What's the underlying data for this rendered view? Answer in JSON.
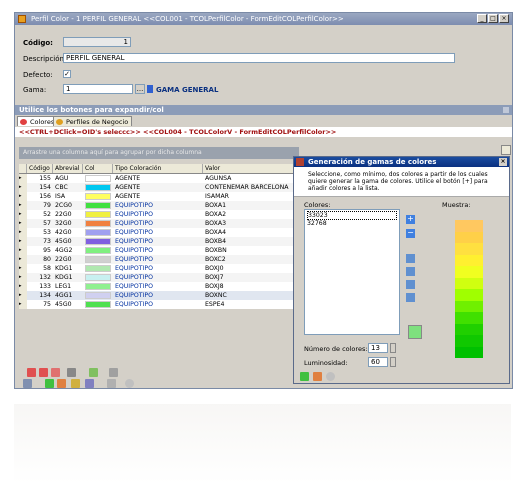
{
  "window": {
    "title": "Perfil Color - 1  PERFIL GENERAL  <<COL001 - TCOLPerfilColor - FormEditCOLPerfilColor>>",
    "controls": [
      "_",
      "□",
      "×"
    ]
  },
  "form": {
    "codigo_label": "Código:",
    "codigo_value": "1",
    "descripcion_label": "Descripción:",
    "descripcion_value": "PERFIL GENERAL",
    "defecto_label": "Defecto:",
    "defecto_checked": "✓",
    "gama_label": "Gama:",
    "gama_value": "1",
    "gama_button": "...",
    "gama_name": "GAMA GENERAL"
  },
  "expand_bar": "Utilice los botones para expandir/col",
  "tabs": [
    {
      "label": "Colores"
    },
    {
      "label": "Perfiles de Negocio"
    }
  ],
  "ctrl_bar": "<<CTRL+DClick=OID's seleccc>> <<COL004 - TCOLColorV - FormEditCOLPerfilColor>>",
  "grid": {
    "group_hint": "Arrastre una columna aquí para agrupar por dicha columna",
    "headers": [
      "Código",
      "Abrevial",
      "Col",
      "Tipo Coloración",
      "Valor"
    ],
    "rows": [
      {
        "codigo": "155",
        "abrev": "AGU",
        "color": "#ffffff",
        "tipo": "AGENTE",
        "valor": "AGUNSA"
      },
      {
        "codigo": "154",
        "abrev": "CBC",
        "color": "#00c8f0",
        "tipo": "AGENTE",
        "valor": "CONTENEMAR BARCELONA"
      },
      {
        "codigo": "156",
        "abrev": "ISA",
        "color": "#ffff60",
        "tipo": "AGENTE",
        "valor": "ISAMAR"
      },
      {
        "codigo": "79",
        "abrev": "2CG0",
        "color": "#40e040",
        "tipo": "EQUIPOTIPO",
        "valor": "BOXA1"
      },
      {
        "codigo": "52",
        "abrev": "22G0",
        "color": "#f0f040",
        "tipo": "EQUIPOTIPO",
        "valor": "BOXA2"
      },
      {
        "codigo": "57",
        "abrev": "32G0",
        "color": "#f08040",
        "tipo": "EQUIPOTIPO",
        "valor": "BOXA3"
      },
      {
        "codigo": "53",
        "abrev": "42G0",
        "color": "#a0a0f0",
        "tipo": "EQUIPOTIPO",
        "valor": "BOXA4"
      },
      {
        "codigo": "73",
        "abrev": "45G0",
        "color": "#8060e0",
        "tipo": "EQUIPOTIPO",
        "valor": "BOXB4"
      },
      {
        "codigo": "95",
        "abrev": "4GG2",
        "color": "#80f080",
        "tipo": "EQUIPOTIPO",
        "valor": "BOXBN"
      },
      {
        "codigo": "80",
        "abrev": "22G0",
        "color": "#d0d0d0",
        "tipo": "EQUIPOTIPO",
        "valor": "BOXC2"
      },
      {
        "codigo": "58",
        "abrev": "KDG1",
        "color": "#b0e8b0",
        "tipo": "EQUIPOTIPO",
        "valor": "BOXJ0"
      },
      {
        "codigo": "132",
        "abrev": "KDG1",
        "color": "#c8f0f0",
        "tipo": "EQUIPOTIPO",
        "valor": "BOXJ7"
      },
      {
        "codigo": "133",
        "abrev": "LEG1",
        "color": "#90f090",
        "tipo": "EQUIPOTIPO",
        "valor": "BOXJ8"
      },
      {
        "codigo": "134",
        "abrev": "4GG1",
        "color": "#d0d0f0",
        "tipo": "EQUIPOTIPO",
        "valor": "BOXNC"
      },
      {
        "codigo": "75",
        "abrev": "45G0",
        "color": "#50e050",
        "tipo": "EQUIPOTIPO",
        "valor": "ESPE4"
      }
    ]
  },
  "dialog": {
    "title": "Generación de gamas de colores",
    "info": "Seleccione, como mínimo, dos colores a partir de los cuales quiere generar la gama de colores. Utilice el botón [+] para añadir colores a la lista.",
    "colores_label": "Colores:",
    "colores": [
      "33023",
      "32768"
    ],
    "muestra_label": "Muestra:",
    "numero_label": "Número de colores:",
    "numero_value": "13",
    "luminosidad_label": "Luminosidad:",
    "luminosidad_value": "60",
    "gradient": [
      "#ffc860",
      "#ffd048",
      "#ffe040",
      "#fff030",
      "#f0ff20",
      "#d0ff10",
      "#a0ff00",
      "#70f000",
      "#40e000",
      "#20d000",
      "#10c800",
      "#00c000"
    ],
    "add_color_preview": "#7ee07e"
  },
  "colors": {
    "accent": "#0a3080",
    "title": "#8c9cb8",
    "ctrl_text": "#a01010"
  }
}
